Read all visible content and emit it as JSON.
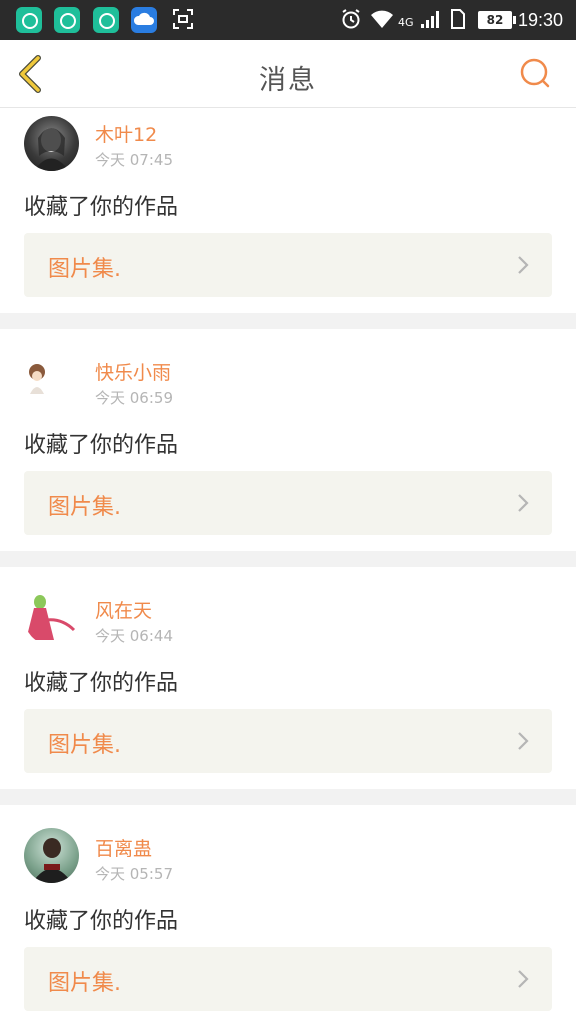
{
  "status_bar": {
    "network": "4G",
    "battery": "82",
    "time": "19:30",
    "icons": [
      "app-store-icon",
      "app-store-icon",
      "app-store-icon",
      "cloud-icon",
      "screenshot-icon",
      "alarm-icon",
      "wifi-icon",
      "signal-icon",
      "sim-icon",
      "battery-icon"
    ]
  },
  "header": {
    "title": "消息",
    "back_icon": "chevron-left-icon",
    "search_icon": "search-icon"
  },
  "colors": {
    "accent": "#f08a4b",
    "back_arrow": "#f0c93c",
    "time_text": "#b5b5b5",
    "body_text": "#333333",
    "work_box_bg": "#f4f4ee"
  },
  "messages": [
    {
      "username": "木叶12",
      "time": "今天 07:45",
      "action": "收藏了你的作品",
      "work_title": "图片集."
    },
    {
      "username": "快乐小雨",
      "time": "今天 06:59",
      "action": "收藏了你的作品",
      "work_title": "图片集."
    },
    {
      "username": "风在天",
      "time": "今天 06:44",
      "action": "收藏了你的作品",
      "work_title": "图片集."
    },
    {
      "username": "百离蛊",
      "time": "今天 05:57",
      "action": "收藏了你的作品",
      "work_title": "图片集."
    }
  ]
}
